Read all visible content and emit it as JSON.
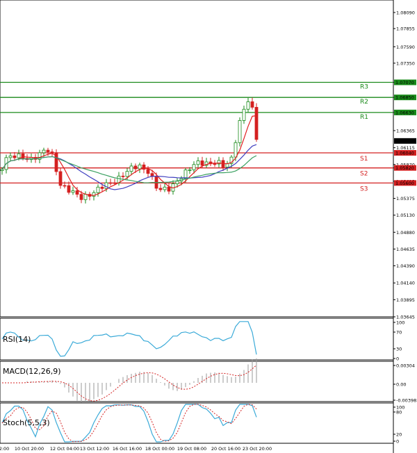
{
  "chart_data": {
    "type": "candlestick",
    "instrument_price_current": "1.06214",
    "y_ticks": [
      "1.08090",
      "1.07855",
      "1.07590",
      "1.07350",
      "1.07070",
      "1.06850",
      "1.06630",
      "1.06365",
      "1.06115",
      "1.05870",
      "1.05820",
      "1.05625",
      "1.05375",
      "1.05130",
      "1.04880",
      "1.04635",
      "1.04390",
      "1.04140",
      "1.03895",
      "1.03645"
    ],
    "x_labels": [
      "2:00",
      "10 Oct 20:00",
      "12 Oct 04:00",
      "13 Oct 12:00",
      "16 Oct 16:00",
      "18 Oct 00:00",
      "19 Oct 08:00",
      "20 Oct 16:00",
      "23 Oct 20:00"
    ],
    "levels": [
      {
        "name": "R3",
        "value": 1.0707,
        "label": "1.07070",
        "color": "#1a8a1a"
      },
      {
        "name": "R2",
        "value": 1.0685,
        "label": "1.06850",
        "color": "#1a8a1a"
      },
      {
        "name": "R1",
        "value": 1.0663,
        "label": "1.06630",
        "color": "#1a8a1a"
      },
      {
        "name": "S1",
        "value": 1.0604,
        "label": "1.06040",
        "color": "#d42020"
      },
      {
        "name": "S2",
        "value": 1.0582,
        "label": "1.05820",
        "color": "#d42020"
      },
      {
        "name": "S3",
        "value": 1.056,
        "label": "1.05600",
        "color": "#d42020"
      }
    ],
    "indicators": [
      {
        "name": "RSI(14)",
        "ticks": [
          "100",
          "70",
          "30",
          "0"
        ]
      },
      {
        "name": "MACD(12,26,9)",
        "ticks": [
          "0.00304",
          "0.00",
          "-0.003983"
        ]
      },
      {
        "name": "Stoch(5,5,3)",
        "ticks": [
          "100",
          "80",
          "20",
          "0"
        ]
      }
    ],
    "colors": {
      "up": "#1a8a1a",
      "down": "#d42020",
      "ma_fast": "#e02020",
      "ma_mid": "#4040c0",
      "ma_slow": "#3aa060",
      "rsi": "#3aaad8",
      "stoch_main": "#3aaad8",
      "stoch_signal": "#d42020",
      "macd_hist": "#9a9a9a",
      "macd_signal": "#d42020"
    }
  }
}
